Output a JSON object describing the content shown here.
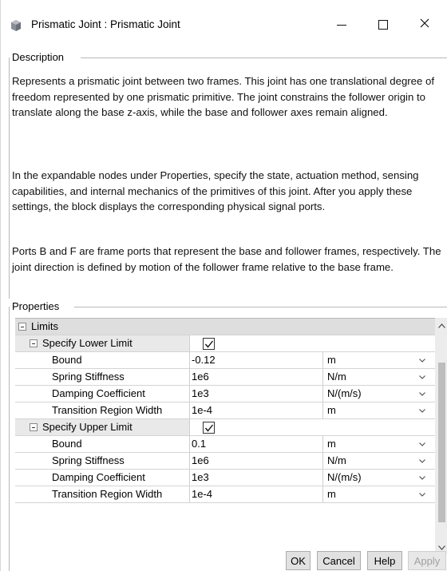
{
  "window": {
    "title": "Prismatic Joint : Prismatic Joint",
    "minimize_glyph": "—",
    "close_glyph": "✕"
  },
  "description": {
    "legend": "Description",
    "paragraphs": [
      "Represents a prismatic joint between two frames. This joint has one translational degree of freedom represented by one prismatic primitive. The joint constrains the follower origin to translate along the base z-axis, while the base and follower axes remain aligned.",
      "In the expandable nodes under Properties, specify the state, actuation method, sensing capabilities, and internal mechanics of the primitives of this joint. After you apply these settings, the block displays the corresponding physical signal ports.",
      "Ports B and F are frame ports that represent the base and follower frames, respectively. The joint direction is defined by motion of the follower frame relative to the base frame."
    ]
  },
  "properties": {
    "legend": "Properties",
    "group_label": "Limits",
    "lower": {
      "label": "Specify Lower Limit",
      "checked": true,
      "rows": [
        {
          "name": "Bound",
          "value": "-0.12",
          "unit": "m"
        },
        {
          "name": "Spring Stiffness",
          "value": "1e6",
          "unit": "N/m"
        },
        {
          "name": "Damping Coefficient",
          "value": "1e3",
          "unit": "N/(m/s)"
        },
        {
          "name": "Transition Region Width",
          "value": "1e-4",
          "unit": "m"
        }
      ]
    },
    "upper": {
      "label": "Specify Upper Limit",
      "checked": true,
      "rows": [
        {
          "name": "Bound",
          "value": "0.1",
          "unit": "m"
        },
        {
          "name": "Spring Stiffness",
          "value": "1e6",
          "unit": "N/m"
        },
        {
          "name": "Damping Coefficient",
          "value": "1e3",
          "unit": "N/(m/s)"
        },
        {
          "name": "Transition Region Width",
          "value": "1e-4",
          "unit": "m"
        }
      ]
    }
  },
  "buttons": {
    "ok": "OK",
    "cancel": "Cancel",
    "help": "Help",
    "apply": "Apply"
  },
  "colors": {
    "group_row_bg": "#dedede",
    "apply_disabled_text": "#a0a0a0"
  },
  "icons": {
    "app": "simscape-block-icon",
    "expander": "collapse-minus-icon",
    "dropdown": "chevron-down-icon"
  }
}
